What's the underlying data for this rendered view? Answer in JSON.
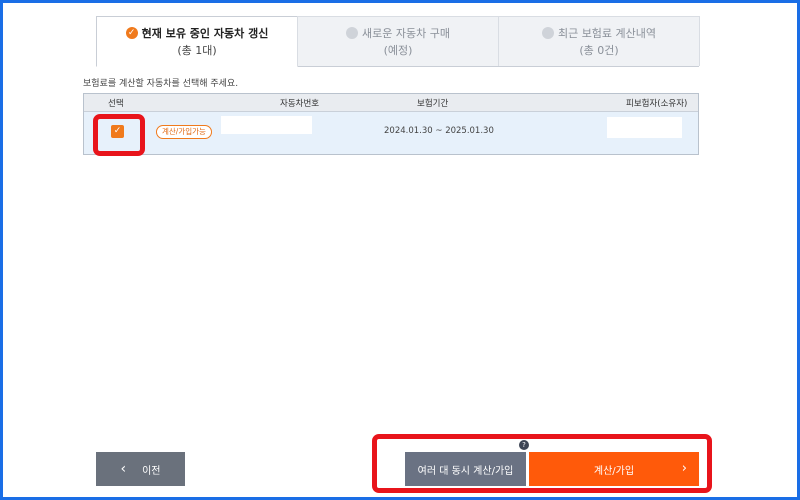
{
  "tabs": [
    {
      "label": "현재 보유 중인 자동차 갱신",
      "sub": "(총 1대)",
      "active": true,
      "icon": "check-circle-icon"
    },
    {
      "label": "새로운 자동차 구매",
      "sub": "(예정)",
      "active": false,
      "icon": "circle-icon"
    },
    {
      "label": "최근 보험료 계산내역",
      "sub": "(총 0건)",
      "active": false,
      "icon": "circle-icon"
    }
  ],
  "instruction": "보험료를 계산할 자동차를 선택해 주세요.",
  "table": {
    "headers": {
      "select": "선택",
      "car_number": "자동차번호",
      "period": "보험기간",
      "insured": "피보험자(소유자)"
    },
    "row": {
      "checked": true,
      "badge": "계산/가입가능",
      "car_number": "",
      "period": "2024.01.30 ~ 2025.01.30",
      "insured": ""
    }
  },
  "buttons": {
    "prev_icon": "‹",
    "prev": "이전",
    "multi": "여러 대 동시 계산/가입",
    "help": "?",
    "calc": "계산/가입",
    "calc_arrow": "›"
  },
  "colors": {
    "accent": "#ff5a0a",
    "highlight": "#e8141b",
    "frame": "#1a6ee6"
  }
}
